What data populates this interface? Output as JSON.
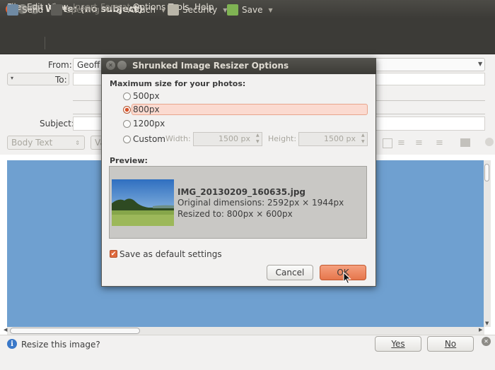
{
  "window": {
    "title": "Write: (no subject)"
  },
  "menu": {
    "items": [
      {
        "label": "File",
        "enabled": true
      },
      {
        "label": "Edit",
        "enabled": true
      },
      {
        "label": "View",
        "enabled": true
      },
      {
        "label": "Insert",
        "enabled": false
      },
      {
        "label": "Format",
        "enabled": false
      },
      {
        "label": "Options",
        "enabled": true
      },
      {
        "label": "Tools",
        "enabled": true
      },
      {
        "label": "Help",
        "enabled": true
      }
    ]
  },
  "toolbar": {
    "send": "Send",
    "spelling": "Spelling",
    "attach": "Attach",
    "security": "Security",
    "save": "Save"
  },
  "header": {
    "from_label": "From:",
    "from_value": "Geoff",
    "to_label": "To:",
    "subject_label": "Subject:"
  },
  "format": {
    "paragraph_style": "Body Text",
    "font_partial": "Va"
  },
  "dialog": {
    "title": "Shrunked Image Resizer Options",
    "max_size_heading": "Maximum size for your photos:",
    "options": [
      {
        "label": "500px",
        "selected": false
      },
      {
        "label": "800px",
        "selected": true
      },
      {
        "label": "1200px",
        "selected": false
      }
    ],
    "custom": {
      "label": "Custom",
      "width_label": "Width:",
      "width_value": "1500 px",
      "height_label": "Height:",
      "height_value": "1500 px"
    },
    "preview_heading": "Preview:",
    "preview": {
      "filename": "IMG_20130209_160635.jpg",
      "original": "Original dimensions: 2592px × 1944px",
      "resized": "Resized to: 800px × 600px"
    },
    "save_default_label": "Save as default settings",
    "save_default_checked": true,
    "cancel_label": "Cancel",
    "ok_label": "OK"
  },
  "infobar": {
    "message": "Resize this image?",
    "yes_label": "Yes",
    "no_label": "No"
  },
  "colors": {
    "accent": "#df4a16",
    "selection_bg": "#fbdad0",
    "titlebar_bg": "#3c3b37",
    "compose_bg": "#6fa0d0"
  }
}
